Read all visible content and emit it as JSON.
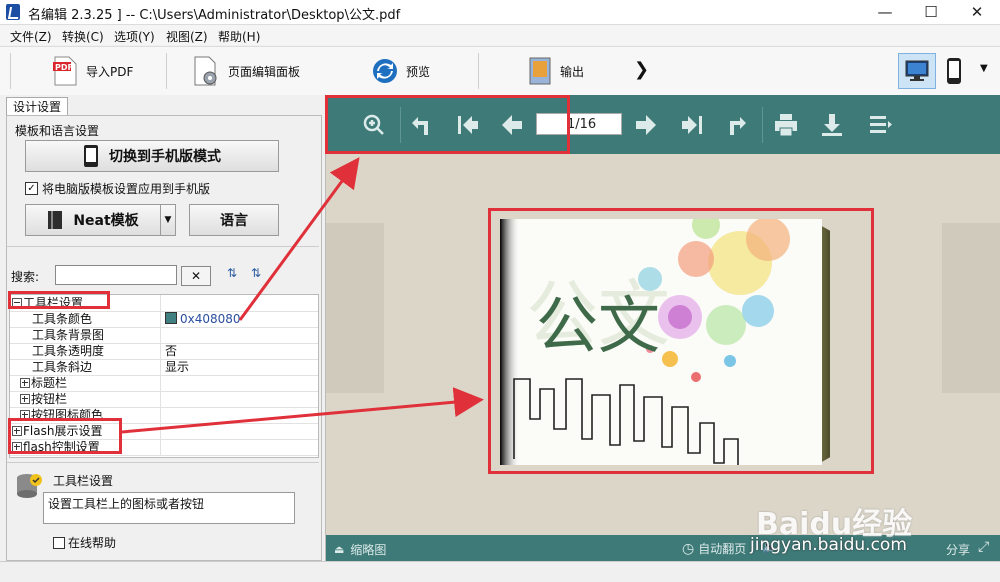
{
  "window": {
    "title": "名编辑           2.3.25 ] -- C:\\Users\\Administrator\\Desktop\\公文.pdf",
    "minimize": "—",
    "maximize": "☐",
    "close": "✕"
  },
  "menu": [
    "文件(Z)",
    "转换(C)",
    "选项(Y)",
    "视图(Z)",
    "帮助(H)"
  ],
  "toolbar": {
    "import_pdf": "导入PDF",
    "page_editor": "页面编辑面板",
    "preview": "预览",
    "output": "输出",
    "more": "❯"
  },
  "left": {
    "tab": "设计设置",
    "template_group": "模板和语言设置",
    "switch_mobile": "切换到手机版模式",
    "apply_checkbox": "将电脑版模板设置应用到手机版",
    "template_name": "Neat模板",
    "language": "语言",
    "search_label": "搜索:",
    "search_value": "",
    "props": [
      {
        "key": "工具栏设置",
        "value": "",
        "indent": 0,
        "box": "minus"
      },
      {
        "key": "工具条颜色",
        "value": "0x408080",
        "indent": 2,
        "box": ""
      },
      {
        "key": "工具条背景图",
        "value": "",
        "indent": 2,
        "box": ""
      },
      {
        "key": "工具条透明度",
        "value": "否",
        "indent": 2,
        "box": ""
      },
      {
        "key": "工具条斜边",
        "value": "显示",
        "indent": 2,
        "box": ""
      },
      {
        "key": "标题栏",
        "value": "",
        "indent": 1,
        "box": "plus"
      },
      {
        "key": "按钮栏",
        "value": "",
        "indent": 1,
        "box": "plus"
      },
      {
        "key": "按钮图标颜色",
        "value": "",
        "indent": 1,
        "box": "plus"
      },
      {
        "key": "Flash展示设置",
        "value": "",
        "indent": 0,
        "box": "plus"
      },
      {
        "key": "flash控制设置",
        "value": "",
        "indent": 0,
        "box": "plus"
      }
    ],
    "help_title": "工具栏设置",
    "help_text": "设置工具栏上的图标或者按钮",
    "online_help": "在线帮助"
  },
  "preview": {
    "page_indicator": "1/16",
    "thumbnails": "缩略图",
    "autoflip": "自动翻页",
    "share": "分享",
    "book_title": "公文"
  },
  "watermark": {
    "brand": "Baidu经验",
    "url": "jingyan.baidu.com"
  },
  "colors": {
    "toolbar_teal": "#3e7a78",
    "swatch": "#408080",
    "annotation_red": "#e0303a"
  }
}
